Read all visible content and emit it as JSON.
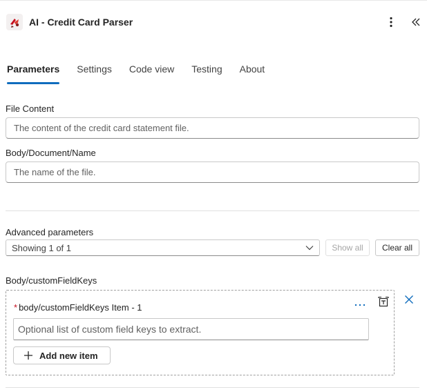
{
  "header": {
    "title": "AI - Credit Card Parser",
    "icon": "ai-builder-icon",
    "accent_color": "#c50f1f"
  },
  "tabs": [
    {
      "label": "Parameters",
      "active": true
    },
    {
      "label": "Settings",
      "active": false
    },
    {
      "label": "Code view",
      "active": false
    },
    {
      "label": "Testing",
      "active": false
    },
    {
      "label": "About",
      "active": false
    }
  ],
  "fields": {
    "file_content": {
      "label": "File Content",
      "placeholder": "The content of the credit card statement file."
    },
    "name": {
      "label": "Body/Document/Name",
      "placeholder": "The name of the file."
    }
  },
  "advanced": {
    "label": "Advanced parameters",
    "select_value": "Showing 1 of 1",
    "show_all_label": "Show all",
    "clear_all_label": "Clear all"
  },
  "array": {
    "label": "Body/customFieldKeys",
    "item_required_marker": "*",
    "item_label": "body/customFieldKeys Item - 1",
    "item_placeholder": "Optional list of custom field keys to extract.",
    "add_item_label": "Add new item"
  },
  "colors": {
    "tab_accent": "#0f6cbd",
    "remove_icon": "#0f6cbd"
  }
}
